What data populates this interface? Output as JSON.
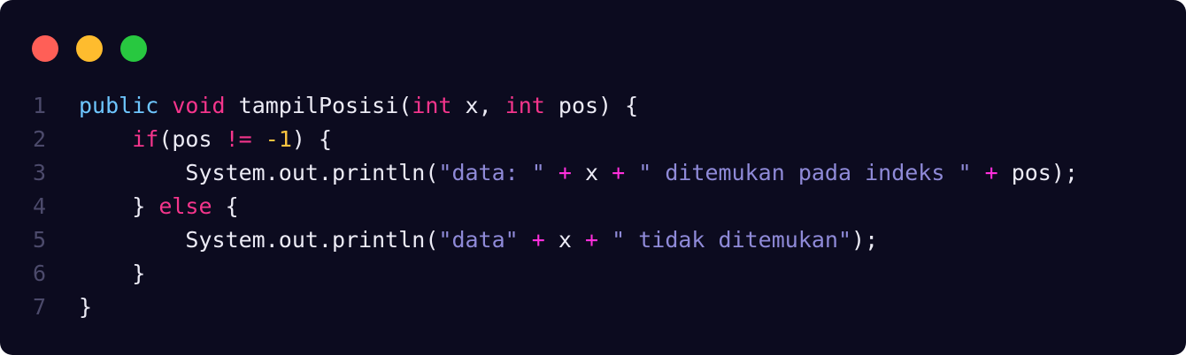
{
  "window": {
    "background": "#0c0b1f",
    "buttons": [
      {
        "name": "close",
        "color": "#ff5f57"
      },
      {
        "name": "minimize",
        "color": "#febc2e"
      },
      {
        "name": "zoom",
        "color": "#28c840"
      }
    ]
  },
  "palette": {
    "default": "#ecebf5",
    "keyword_blue": "#6ec6ff",
    "keyword_pink": "#f5358c",
    "operator": "#ff2fdc",
    "number": "#f9c440",
    "string": "#8f8ad8",
    "line_number": "#4c4a6b"
  },
  "lines": [
    {
      "number": "1",
      "tokens": [
        {
          "text": "public",
          "type": "keyword_blue"
        },
        {
          "text": " ",
          "type": "default"
        },
        {
          "text": "void",
          "type": "keyword_pink"
        },
        {
          "text": " tampilPosisi(",
          "type": "default"
        },
        {
          "text": "int",
          "type": "keyword_pink"
        },
        {
          "text": " x, ",
          "type": "default"
        },
        {
          "text": "int",
          "type": "keyword_pink"
        },
        {
          "text": " pos) {",
          "type": "default"
        }
      ]
    },
    {
      "number": "2",
      "tokens": [
        {
          "text": "    ",
          "type": "default"
        },
        {
          "text": "if",
          "type": "keyword_pink"
        },
        {
          "text": "(pos ",
          "type": "default"
        },
        {
          "text": "!=",
          "type": "keyword_pink"
        },
        {
          "text": " ",
          "type": "default"
        },
        {
          "text": "-1",
          "type": "number"
        },
        {
          "text": ") {",
          "type": "default"
        }
      ]
    },
    {
      "number": "3",
      "tokens": [
        {
          "text": "        System.out.println(",
          "type": "default"
        },
        {
          "text": "\"data: \"",
          "type": "string"
        },
        {
          "text": " ",
          "type": "default"
        },
        {
          "text": "+",
          "type": "operator"
        },
        {
          "text": " x ",
          "type": "default"
        },
        {
          "text": "+",
          "type": "operator"
        },
        {
          "text": " ",
          "type": "default"
        },
        {
          "text": "\" ditemukan pada indeks \"",
          "type": "string"
        },
        {
          "text": " ",
          "type": "default"
        },
        {
          "text": "+",
          "type": "operator"
        },
        {
          "text": " pos);",
          "type": "default"
        }
      ]
    },
    {
      "number": "4",
      "tokens": [
        {
          "text": "    } ",
          "type": "default"
        },
        {
          "text": "else",
          "type": "keyword_pink"
        },
        {
          "text": " {",
          "type": "default"
        }
      ]
    },
    {
      "number": "5",
      "tokens": [
        {
          "text": "        System.out.println(",
          "type": "default"
        },
        {
          "text": "\"data\"",
          "type": "string"
        },
        {
          "text": " ",
          "type": "default"
        },
        {
          "text": "+",
          "type": "operator"
        },
        {
          "text": " x ",
          "type": "default"
        },
        {
          "text": "+",
          "type": "operator"
        },
        {
          "text": " ",
          "type": "default"
        },
        {
          "text": "\" tidak ditemukan\"",
          "type": "string"
        },
        {
          "text": ");",
          "type": "default"
        }
      ]
    },
    {
      "number": "6",
      "tokens": [
        {
          "text": "    }",
          "type": "default"
        }
      ]
    },
    {
      "number": "7",
      "tokens": [
        {
          "text": "}",
          "type": "default"
        }
      ]
    }
  ]
}
